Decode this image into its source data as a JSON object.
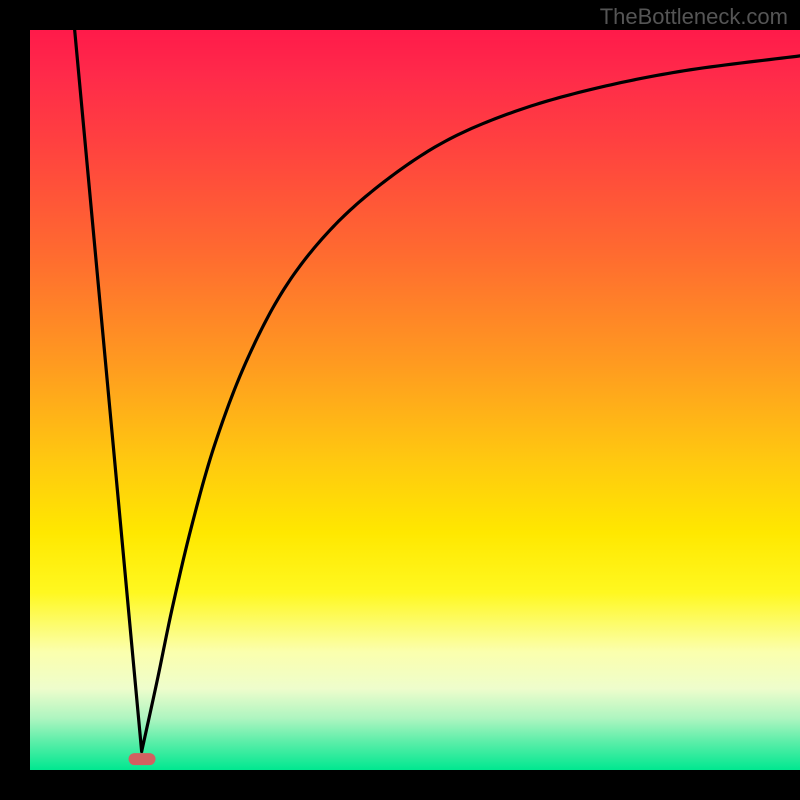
{
  "watermark": "TheBottleneck.com",
  "chart_data": {
    "type": "line",
    "title": "",
    "xlabel": "",
    "ylabel": "",
    "xlim": [
      0,
      100
    ],
    "ylim": [
      0,
      100
    ],
    "curve": {
      "left_branch": [
        {
          "x": 5.8,
          "y": 100
        },
        {
          "x": 14.5,
          "y": 2.5
        }
      ],
      "right_branch": [
        {
          "x": 14.5,
          "y": 2.5
        },
        {
          "x": 16.5,
          "y": 12
        },
        {
          "x": 18.5,
          "y": 22
        },
        {
          "x": 21,
          "y": 33
        },
        {
          "x": 24,
          "y": 44
        },
        {
          "x": 28,
          "y": 55
        },
        {
          "x": 33,
          "y": 65
        },
        {
          "x": 39,
          "y": 73
        },
        {
          "x": 46,
          "y": 79.5
        },
        {
          "x": 54,
          "y": 85
        },
        {
          "x": 63,
          "y": 89
        },
        {
          "x": 73,
          "y": 92
        },
        {
          "x": 85,
          "y": 94.5
        },
        {
          "x": 100,
          "y": 96.5
        }
      ],
      "apex": {
        "x": 14.5,
        "y": 2.5
      }
    },
    "marker": {
      "x": 14.5,
      "y": 1.5,
      "width_pct": 3.5,
      "height_pct": 1.6,
      "color": "#d26060"
    },
    "gradient_stops": [
      {
        "pos": 0,
        "color": "#ff1a4a"
      },
      {
        "pos": 15,
        "color": "#ff4040"
      },
      {
        "pos": 45,
        "color": "#ff9a20"
      },
      {
        "pos": 68,
        "color": "#ffe800"
      },
      {
        "pos": 84,
        "color": "#fbffad"
      },
      {
        "pos": 93,
        "color": "#aef5c0"
      },
      {
        "pos": 100,
        "color": "#00e890"
      }
    ]
  }
}
